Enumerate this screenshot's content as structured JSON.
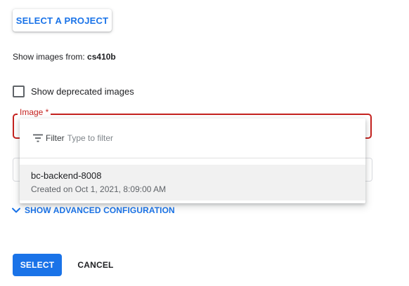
{
  "header": {
    "select_project_label": "SELECT A PROJECT"
  },
  "source": {
    "prefix": "Show images from: ",
    "project": "cs410b"
  },
  "deprecated": {
    "label": "Show deprecated images",
    "checked": false
  },
  "image_field": {
    "label": "Image *"
  },
  "dropdown": {
    "filter_label": "Filter",
    "filter_placeholder": "Type to filter",
    "options": [
      {
        "name": "bc-backend-8008",
        "created": "Created on Oct 1, 2021, 8:09:00 AM"
      }
    ]
  },
  "advanced": {
    "label": "SHOW ADVANCED CONFIGURATION"
  },
  "actions": {
    "select_label": "SELECT",
    "cancel_label": "CANCEL"
  },
  "colors": {
    "accent": "#1a73e8",
    "error": "#c5221f",
    "highlight": "#f1f1f1"
  },
  "icons": {
    "filter": "filter-icon",
    "advanced_toggle": "chevron-down-icon"
  }
}
